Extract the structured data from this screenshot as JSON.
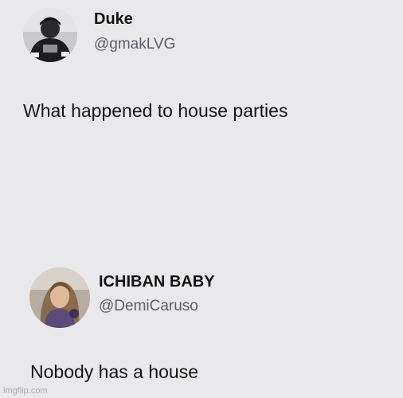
{
  "tweets": [
    {
      "display_name": "Duke",
      "handle": "@gmakLVG",
      "text": "What happened to house parties",
      "avatar_icon": "profile-photo-icon"
    },
    {
      "display_name": "ICHIBAN BABY",
      "handle": "@DemiCaruso",
      "text": "Nobody has a house",
      "avatar_icon": "profile-photo-icon"
    }
  ],
  "watermark": "imgflip.com",
  "colors": {
    "background": "#e9e9eb",
    "name_text": "#111111",
    "handle_text": "#5d6066",
    "body_text": "#141414"
  }
}
